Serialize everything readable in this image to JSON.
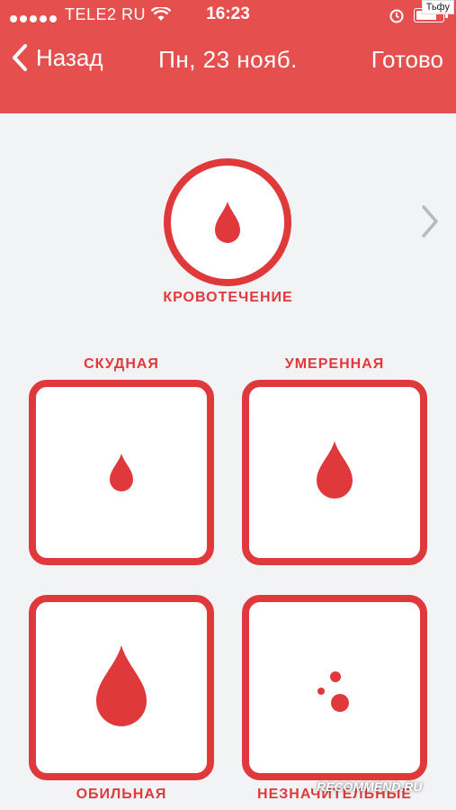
{
  "status_bar": {
    "carrier": "TELE2 RU",
    "time": "16:23",
    "watermark": "Тьфу"
  },
  "nav": {
    "back_label": "Назад",
    "title": "Пн, 23 нояб.",
    "done_label": "Готово"
  },
  "category": {
    "label": "КРОВОТЕЧЕНИЕ",
    "icon": "blood-drop-icon"
  },
  "options": [
    {
      "label": "СКУДНАЯ",
      "icon": "small-drop-icon"
    },
    {
      "label": "УМЕРЕННАЯ",
      "icon": "medium-drop-icon"
    },
    {
      "label": "ОБИЛЬНАЯ",
      "icon": "large-drop-icon"
    },
    {
      "label": "НЕЗНАЧИТЕЛЬНЫЕ",
      "icon": "spotting-dots-icon"
    }
  ],
  "watermark_bottom": "RECOMMEND.RU",
  "colors": {
    "header": "#e5504f",
    "accent": "#e0393b",
    "background": "#f1f3f4"
  }
}
